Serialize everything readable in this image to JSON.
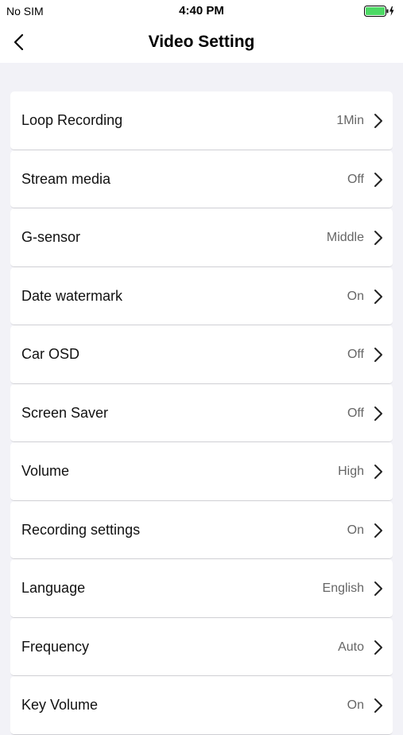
{
  "status_bar": {
    "carrier": "No SIM",
    "time": "4:40 PM",
    "battery_icon": "battery-charging-icon",
    "battery_color": "#4cd964"
  },
  "nav": {
    "back_icon": "chevron-left-icon",
    "title": "Video Setting"
  },
  "settings": [
    {
      "label": "Loop Recording",
      "value": "1Min"
    },
    {
      "label": "Stream media",
      "value": "Off"
    },
    {
      "label": "G-sensor",
      "value": "Middle"
    },
    {
      "label": "Date watermark",
      "value": "On"
    },
    {
      "label": "Car OSD",
      "value": "Off"
    },
    {
      "label": "Screen Saver",
      "value": "Off"
    },
    {
      "label": "Volume",
      "value": "High"
    },
    {
      "label": "Recording settings",
      "value": "On"
    },
    {
      "label": "Language",
      "value": "English"
    },
    {
      "label": "Frequency",
      "value": "Auto"
    },
    {
      "label": "Key Volume",
      "value": "On"
    }
  ],
  "colors": {
    "background": "#f2f2f7",
    "row_background": "#ffffff",
    "value_text": "#666666",
    "separator": "#cfcfd4"
  }
}
